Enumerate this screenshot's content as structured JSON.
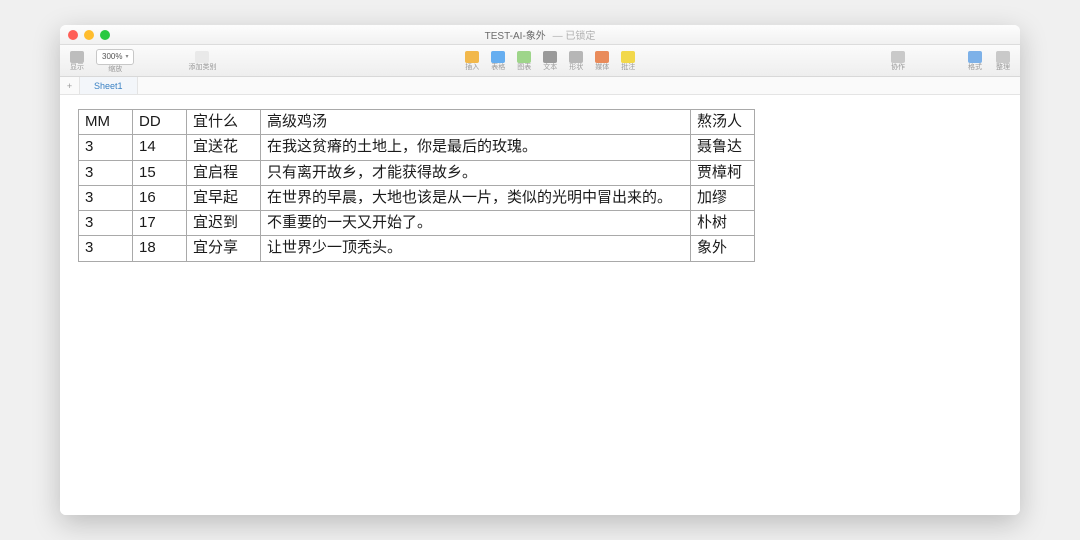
{
  "window": {
    "title": "TEST-AI-象外",
    "subtitle": "— 已锁定"
  },
  "toolbar": {
    "zoom": "300%",
    "left": [
      {
        "name": "view-icon",
        "label": "显示",
        "color": "#bdbdbd"
      },
      {
        "name": "zoom-control",
        "label": "缩放"
      }
    ],
    "addcat": {
      "name": "add-category-icon",
      "label": "添加类别",
      "color": "#e9e9e9"
    },
    "center": [
      {
        "name": "insert-icon",
        "label": "插入",
        "color": "#f2b84b"
      },
      {
        "name": "table-icon",
        "label": "表格",
        "color": "#66aef0"
      },
      {
        "name": "chart-icon",
        "label": "图表",
        "color": "#9ed58a"
      },
      {
        "name": "text-icon",
        "label": "文本",
        "color": "#9a9a9a"
      },
      {
        "name": "shape-icon",
        "label": "形状",
        "color": "#b6b6b6"
      },
      {
        "name": "media-icon",
        "label": "媒体",
        "color": "#e98b5a"
      },
      {
        "name": "comment-icon",
        "label": "批注",
        "color": "#f2d84b"
      }
    ],
    "collab": {
      "name": "collaborate-icon",
      "label": "协作",
      "color": "#c9c9c9"
    },
    "right": [
      {
        "name": "format-icon",
        "label": "格式",
        "color": "#7db1e8"
      },
      {
        "name": "organize-icon",
        "label": "整理",
        "color": "#c9c9c9"
      }
    ]
  },
  "sheets": {
    "add_label": "+",
    "tabs": [
      {
        "label": "Sheet1",
        "active": true
      }
    ]
  },
  "table": {
    "headers": [
      "MM",
      "DD",
      "宜什么",
      "高级鸡汤",
      "熬汤人"
    ],
    "rows": [
      [
        "3",
        "14",
        "宜送花",
        "在我这贫瘠的土地上，你是最后的玫瑰。",
        "聂鲁达"
      ],
      [
        "3",
        "15",
        "宜启程",
        "只有离开故乡，才能获得故乡。",
        "贾樟柯"
      ],
      [
        "3",
        "16",
        "宜早起",
        "在世界的早晨，大地也该是从一片，类似的光明中冒出来的。",
        "加缪"
      ],
      [
        "3",
        "17",
        "宜迟到",
        "不重要的一天又开始了。",
        "朴树"
      ],
      [
        "3",
        "18",
        "宜分享",
        "让世界少一顶秃头。",
        "象外"
      ]
    ]
  }
}
